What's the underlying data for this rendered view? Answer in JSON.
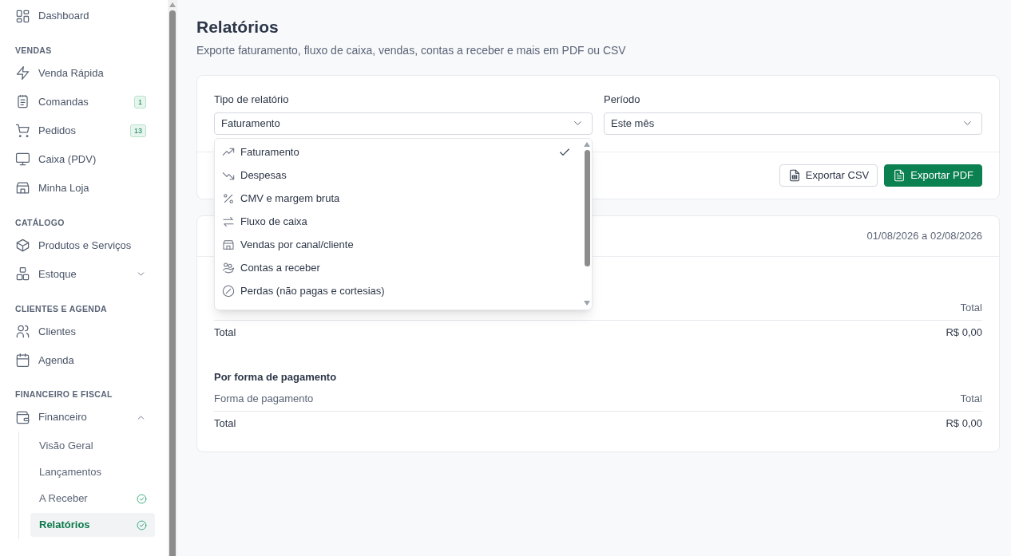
{
  "sidebar": {
    "top": [
      {
        "label": "Dashboard"
      }
    ],
    "sections": [
      {
        "title": "VENDAS",
        "items": [
          {
            "label": "Venda Rápida"
          },
          {
            "label": "Comandas",
            "badge": "1"
          },
          {
            "label": "Pedidos",
            "badge": "13"
          },
          {
            "label": "Caixa (PDV)"
          },
          {
            "label": "Minha Loja"
          }
        ]
      },
      {
        "title": "CATÁLOGO",
        "items": [
          {
            "label": "Produtos e Serviços"
          },
          {
            "label": "Estoque",
            "expanded": false
          }
        ]
      },
      {
        "title": "CLIENTES E AGENDA",
        "items": [
          {
            "label": "Clientes"
          },
          {
            "label": "Agenda"
          }
        ]
      },
      {
        "title": "FINANCEIRO E FISCAL",
        "items": [
          {
            "label": "Financeiro",
            "expanded": true,
            "children": [
              {
                "label": "Visão Geral",
                "selected": false,
                "verified": false
              },
              {
                "label": "Lançamentos",
                "selected": false,
                "verified": false
              },
              {
                "label": "A Receber",
                "selected": false,
                "verified": true
              },
              {
                "label": "Relatórios",
                "selected": true,
                "verified": true
              }
            ]
          }
        ]
      }
    ]
  },
  "page": {
    "title": "Relatórios",
    "subtitle": "Exporte faturamento, fluxo de caixa, vendas, contas a receber e mais em PDF ou CSV"
  },
  "filters": [
    {
      "label": "Tipo de relatório",
      "value": "Faturamento"
    },
    {
      "label": "Período",
      "value": "Este mês"
    }
  ],
  "dropdown": {
    "options": [
      {
        "label": "Faturamento",
        "selected": true
      },
      {
        "label": "Despesas",
        "selected": false
      },
      {
        "label": "CMV e margem bruta",
        "selected": false
      },
      {
        "label": "Fluxo de caixa",
        "selected": false
      },
      {
        "label": "Vendas por canal/cliente",
        "selected": false
      },
      {
        "label": "Contas a receber",
        "selected": false
      },
      {
        "label": "Perdas (não pagas e cortesias)",
        "selected": false
      }
    ]
  },
  "buttons": [
    {
      "label": "Exportar CSV",
      "kind": "outline"
    },
    {
      "label": "Exportar PDF",
      "kind": "primary"
    }
  ],
  "report": {
    "date_range": "01/08/2026 a 02/08/2026",
    "sections": [
      {
        "columns": [
          "",
          "Total"
        ],
        "rows": [
          [
            "Total",
            "R$ 0,00"
          ]
        ]
      },
      {
        "title": "Por forma de pagamento",
        "columns": [
          "Forma de pagamento",
          "Total"
        ],
        "rows": [
          [
            "Total",
            "R$ 0,00"
          ]
        ]
      }
    ]
  }
}
